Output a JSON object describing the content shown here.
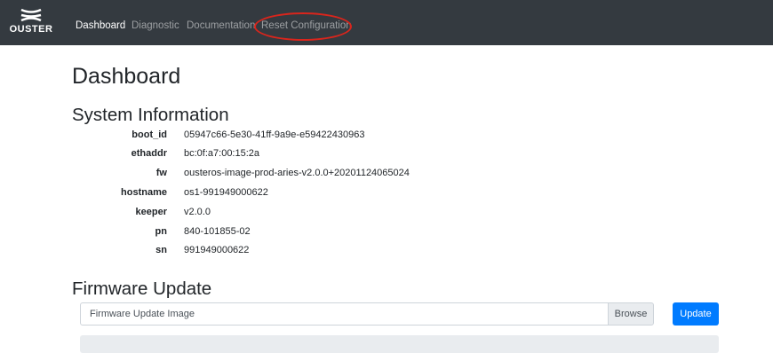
{
  "nav": {
    "brand": "OUSTER",
    "links": [
      "Dashboard",
      "Diagnostic",
      "Documentation",
      "Reset Configuration"
    ],
    "active": "Dashboard",
    "highlighted": "Reset Configuration"
  },
  "page": {
    "title": "Dashboard"
  },
  "system_info": {
    "heading": "System Information",
    "rows": [
      {
        "key": "boot_id",
        "value": "05947c66-5e30-41ff-9a9e-e59422430963"
      },
      {
        "key": "ethaddr",
        "value": "bc:0f:a7:00:15:2a"
      },
      {
        "key": "fw",
        "value": "ousteros-image-prod-aries-v2.0.0+20201124065024"
      },
      {
        "key": "hostname",
        "value": "os1-991949000622"
      },
      {
        "key": "keeper",
        "value": "v2.0.0"
      },
      {
        "key": "pn",
        "value": "840-101855-02"
      },
      {
        "key": "sn",
        "value": "991949000622"
      }
    ]
  },
  "firmware": {
    "heading": "Firmware Update",
    "placeholder": "Firmware Update Image",
    "browse_label": "Browse",
    "update_label": "Update"
  },
  "colors": {
    "navbar": "#343a40",
    "primary": "#007bff",
    "highlight": "#d9251c"
  }
}
